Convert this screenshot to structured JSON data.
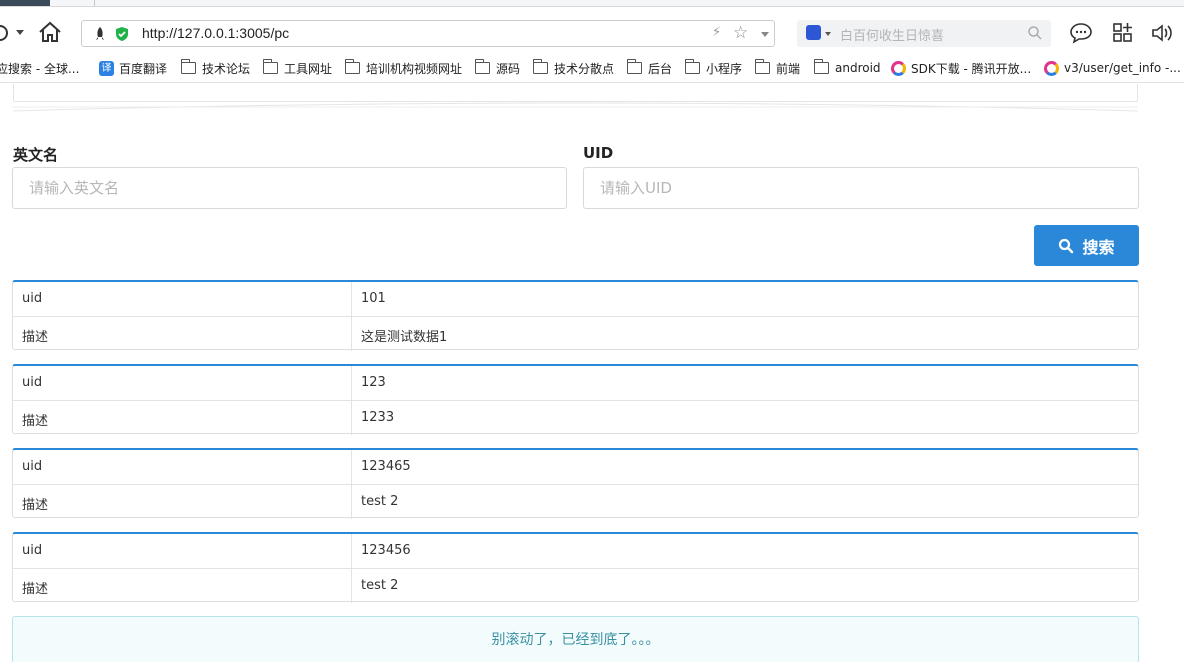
{
  "browser": {
    "url": "http://127.0.0.1:3005/pc",
    "search_placeholder": "白百何收生日惊喜",
    "bookmarks": [
      "应搜索 - 全球...",
      "百度翻译",
      "技术论坛",
      "工具网址",
      "培训机构视频网址",
      "源码",
      "技术分散点",
      "后台",
      "小程序",
      "前端",
      "android",
      "SDK下载 - 腾讯开放...",
      "v3/user/get_info -..."
    ],
    "translate_favicon": "译"
  },
  "form": {
    "english_name_label": "英文名",
    "english_name_placeholder": "请输入英文名",
    "english_name_value": "",
    "uid_label": "UID",
    "uid_placeholder": "请输入UID",
    "uid_value": "",
    "search_label": "搜索"
  },
  "results": [
    {
      "uid_key": "uid",
      "uid": "101",
      "desc_key": "描述",
      "desc": "这是测试数据1"
    },
    {
      "uid_key": "uid",
      "uid": "123",
      "desc_key": "描述",
      "desc": "1233"
    },
    {
      "uid_key": "uid",
      "uid": "123465",
      "desc_key": "描述",
      "desc": "test 2"
    },
    {
      "uid_key": "uid",
      "uid": "123456",
      "desc_key": "描述",
      "desc": "test 2"
    }
  ],
  "end_message": "别滚动了，已经到底了。。。",
  "colors": {
    "accent": "#2b88d8",
    "notice_bg": "#f3fcfd",
    "notice_text": "#3a8fa3"
  }
}
